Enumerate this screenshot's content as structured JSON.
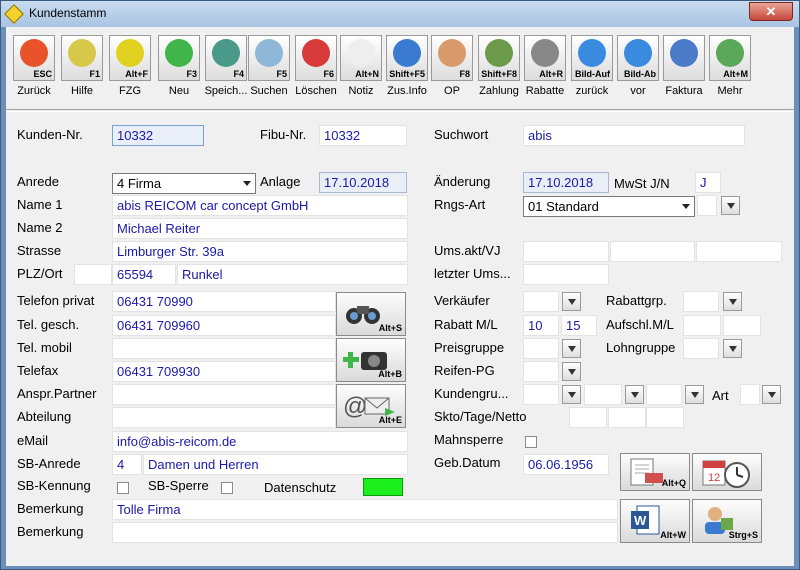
{
  "window": {
    "title": "Kundenstamm",
    "close": "✕"
  },
  "toolbar": [
    {
      "key": "ESC",
      "label": "Zurück",
      "color": "#e8532a",
      "icon": "arrow-left-icon"
    },
    {
      "key": "F1",
      "label": "Hilfe",
      "color": "#d8c84a",
      "icon": "help-icon"
    },
    {
      "key": "Alt+F",
      "label": "FZG",
      "color": "#e0d020",
      "icon": "car-icon"
    },
    {
      "key": "F3",
      "label": "Neu",
      "color": "#3fb54a",
      "icon": "plus-icon"
    },
    {
      "key": "F4",
      "label": "Speich...",
      "color": "#4a9a8a",
      "icon": "save-icon"
    },
    {
      "key": "F5",
      "label": "Suchen",
      "color": "#8fb7d8",
      "icon": "magnifier-icon"
    },
    {
      "key": "F6",
      "label": "Löschen",
      "color": "#d83a3a",
      "icon": "delete-icon"
    },
    {
      "key": "Alt+N",
      "label": "Notiz",
      "color": "#eeeeee",
      "icon": "note-icon"
    },
    {
      "key": "Shift+F5",
      "label": "Zus.Info",
      "color": "#3a7ad0",
      "icon": "info-icon"
    },
    {
      "key": "F8",
      "label": "OP",
      "color": "#d89a6a",
      "icon": "handshake-icon"
    },
    {
      "key": "Shift+F8",
      "label": "Zahlung",
      "color": "#6a9a4a",
      "icon": "money-icon"
    },
    {
      "key": "Alt+R",
      "label": "Rabatte",
      "color": "#888888",
      "icon": "percent-icon"
    },
    {
      "key": "Bild-Auf",
      "label": "zurück",
      "color": "#3a8ae0",
      "icon": "prev-arrow-icon"
    },
    {
      "key": "Bild-Ab",
      "label": "vor",
      "color": "#3a8ae0",
      "icon": "next-arrow-icon"
    },
    {
      "key": "",
      "label": "Faktura",
      "color": "#4a7ac8",
      "icon": "invoice-icon"
    },
    {
      "key": "Alt+M",
      "label": "Mehr",
      "color": "#5aa85a",
      "icon": "more-icon"
    }
  ],
  "labels": {
    "kundennr": "Kunden-Nr.",
    "fibunr": "Fibu-Nr.",
    "suchwort": "Suchwort",
    "anrede": "Anrede",
    "anlage": "Anlage",
    "aenderung": "Änderung",
    "mwst": "MwSt J/N",
    "name1": "Name 1",
    "rngsart": "Rngs-Art",
    "name2": "Name 2",
    "strasse": "Strasse",
    "umsakt": "Ums.akt/VJ",
    "plzort": "PLZ/Ort",
    "letzterums": "letzter Ums...",
    "telprivat": "Telefon privat",
    "verkaeufer": "Verkäufer",
    "rabattgrp": "Rabattgrp.",
    "telgesch": "Tel. gesch.",
    "rabattml": "Rabatt M/L",
    "aufschl": "Aufschl.M/L",
    "telmobil": "Tel. mobil",
    "preisgruppe": "Preisgruppe",
    "lohngruppe": "Lohngruppe",
    "telefax": "Telefax",
    "reifenpg": "Reifen-PG",
    "anspr": "Anspr.Partner",
    "kundengru": "Kundengru...",
    "art": "Art",
    "abteilung": "Abteilung",
    "skto": "Skto/Tage/Netto",
    "email": "eMail",
    "mahnsperre": "Mahnsperre",
    "sbanrede": "SB-Anrede",
    "gebdatum": "Geb.Datum",
    "sbkennung": "SB-Kennung",
    "sbsperre": "SB-Sperre",
    "datenschutz": "Datenschutz",
    "bemerkung1": "Bemerkung",
    "bemerkung2": "Bemerkung"
  },
  "values": {
    "kundennr": "10332",
    "fibunr": "10332",
    "suchwort": "abis",
    "anrede": "4 Firma",
    "anlage": "17.10.2018",
    "aenderung": "17.10.2018",
    "mwst": "J",
    "name1": "abis REICOM car concept GmbH",
    "rngsart": "01 Standard",
    "name2": "Michael Reiter",
    "strasse": "Limburger Str. 39a",
    "plz": "65594",
    "ort": "Runkel",
    "telprivat": "06431 70990",
    "telgesch": "06431 709960",
    "rabatt_m": "10",
    "rabatt_l": "15",
    "telefax": "06431 709930",
    "email": "info@abis-reicom.de",
    "sbanrede_nr": "4",
    "sbanrede_text": "Damen und Herren",
    "gebdatum": "06.06.1956",
    "bemerkung1": "Tolle Firma"
  },
  "side_buttons": {
    "search": "Alt+S",
    "photo": "Alt+B",
    "mail": "Alt+E"
  },
  "bottom_buttons": {
    "print": "Alt+Q",
    "word": "Alt+W",
    "user": "Strg+S"
  },
  "colors": {
    "datenschutz": "#1cf01c",
    "value_text": "#1a1aa8"
  }
}
